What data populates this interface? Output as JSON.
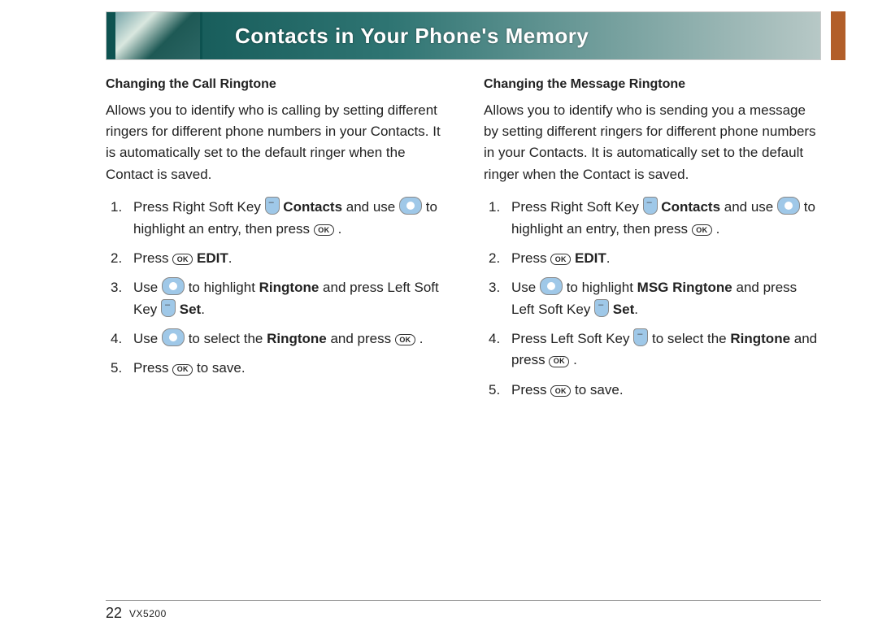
{
  "banner": {
    "title": "Contacts in Your Phone's Memory"
  },
  "left": {
    "heading": "Changing the Call Ringtone",
    "intro": "Allows you to identify who is calling by setting different ringers for different phone numbers in your Contacts. It is automatically set to the default ringer when the Contact is saved.",
    "s1a": "Press Right Soft Key ",
    "s1b": " Contacts",
    "s1c": " and use ",
    "s1d": " to highlight an entry, then press ",
    "s1e": " .",
    "s2a": "Press ",
    "s2b": " EDIT",
    "s2c": ".",
    "s3a": "Use ",
    "s3b": " to highlight ",
    "s3c": "Ringtone",
    "s3d": " and press Left Soft Key ",
    "s3e": " Set",
    "s3f": ".",
    "s4a": "Use ",
    "s4b": " to select the ",
    "s4c": "Ringtone",
    "s4d": " and press ",
    "s4e": " .",
    "s5a": "Press ",
    "s5b": " to save."
  },
  "right": {
    "heading": "Changing the Message Ringtone",
    "intro": "Allows you to identify who is sending you a message by setting different ringers for different phone numbers in your Contacts. It is automatically set to the default ringer when the Contact is saved.",
    "s1a": "Press Right Soft Key ",
    "s1b": " Contacts",
    "s1c": " and use ",
    "s1d": " to highlight an entry, then press ",
    "s1e": " .",
    "s2a": "Press ",
    "s2b": " EDIT",
    "s2c": ".",
    "s3a": "Use ",
    "s3b": " to highlight ",
    "s3c": "MSG Ringtone",
    "s3d": " and press Left Soft Key ",
    "s3e": " Set",
    "s3f": ".",
    "s4a": "Press Left Soft Key ",
    "s4b": " to select the ",
    "s4c": "Ringtone",
    "s4d": " and press ",
    "s4e": " .",
    "s5a": "Press ",
    "s5b": " to save."
  },
  "footer": {
    "page": "22",
    "model": "VX5200"
  },
  "ok_label": "OK"
}
